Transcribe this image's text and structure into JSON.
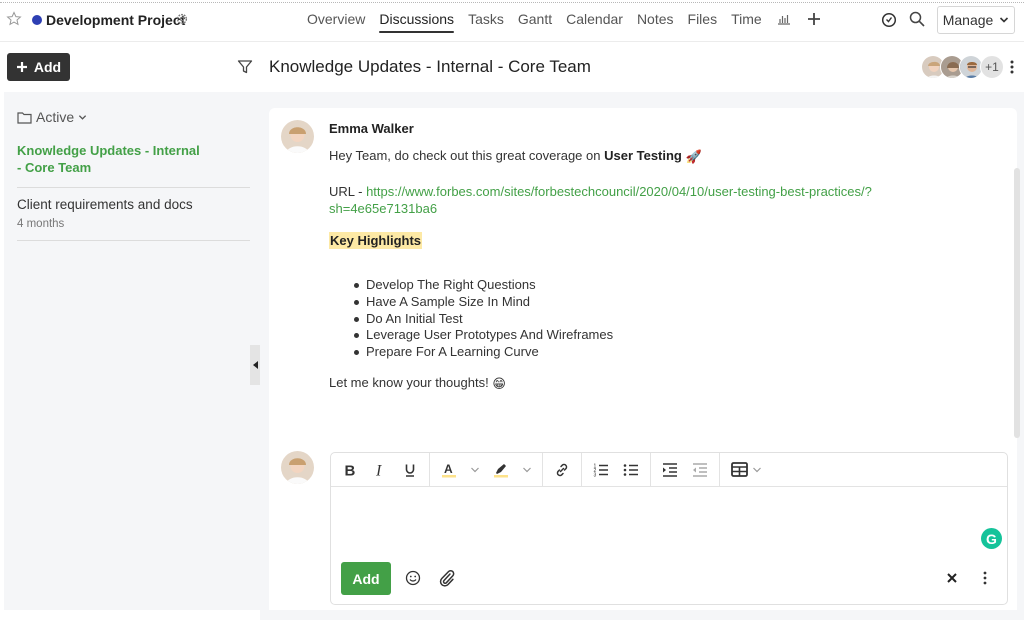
{
  "header": {
    "project_name": "Development Project",
    "project_color": "#2d3fb3",
    "tabs": [
      {
        "label": "Overview",
        "active": false
      },
      {
        "label": "Discussions",
        "active": true
      },
      {
        "label": "Tasks",
        "active": false
      },
      {
        "label": "Gantt",
        "active": false
      },
      {
        "label": "Calendar",
        "active": false
      },
      {
        "label": "Notes",
        "active": false
      },
      {
        "label": "Files",
        "active": false
      },
      {
        "label": "Time",
        "active": false
      }
    ],
    "extra_icons": [
      "reports-icon",
      "plus-icon"
    ],
    "right_icons": [
      "timer-icon",
      "search-icon"
    ],
    "manage_label": "Manage"
  },
  "subheader": {
    "add_label": "Add",
    "title": "Knowledge Updates - Internal - Core Team",
    "members_more": "+1"
  },
  "sidebar": {
    "folder_label": "Active",
    "discussions": [
      {
        "title": "Knowledge Updates - Internal - Core Team",
        "meta": "",
        "active": true
      },
      {
        "title": "Client requirements and docs",
        "meta": "4 months",
        "active": false
      }
    ]
  },
  "message": {
    "author": "Emma Walker",
    "intro": "Hey Team, do check out this great coverage on ",
    "intro_bold": "User Testing",
    "intro_emoji": "🚀",
    "url_prefix": "URL - ",
    "url_line1": "https://www.forbes.com/sites/forbestechcouncil/2020/04/10/user-testing-best-practices/?",
    "url_line2": "sh=4e65e7131ba6",
    "highlight_heading": "Key Highlights",
    "bullets": [
      "Develop The Right Questions",
      "Have A Sample Size In Mind",
      "Do An Initial Test",
      "Leverage User Prototypes And Wireframes",
      "Prepare For A Learning Curve"
    ],
    "closing": "Let me know your thoughts!",
    "closing_emoji": "😁"
  },
  "composer": {
    "toolbar": [
      "bold",
      "italic",
      "underline",
      "text-color",
      "highlight-color",
      "link",
      "numbered-list",
      "bulleted-list",
      "indent",
      "outdent",
      "table"
    ],
    "value": "",
    "submit_label": "Add",
    "grammarly_label": "G"
  },
  "colors": {
    "accent_green": "#43a047",
    "dark_button": "#333333",
    "highlight_yellow": "#fde9a5"
  }
}
